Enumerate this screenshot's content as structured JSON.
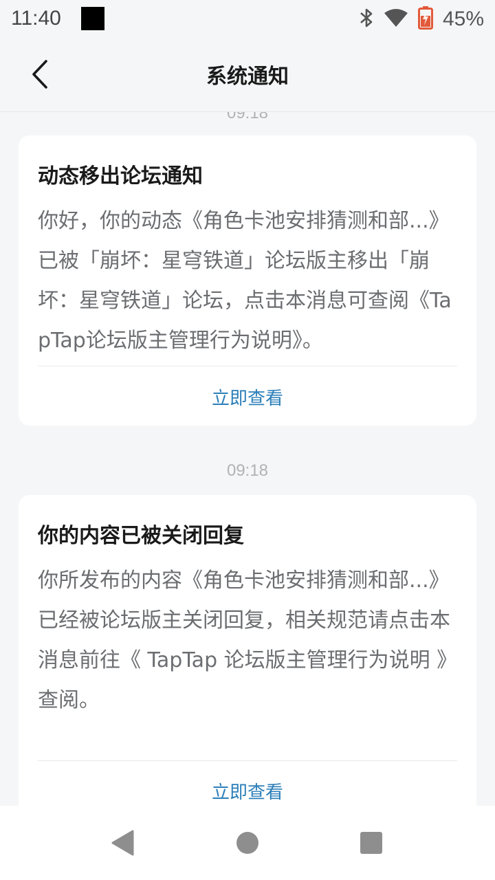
{
  "status_bar": {
    "time": "11:40",
    "battery_percent": "45%",
    "icons": [
      "bluetooth-icon",
      "wifi-icon",
      "battery-icon"
    ]
  },
  "header": {
    "title": "系统通知",
    "back_icon": "chevron-left-icon"
  },
  "notifications": [
    {
      "time": "09:18",
      "title": "动态移出论坛通知",
      "body": "你好，你的动态《角色卡池安排猜测和部...》已被「崩坏：星穹铁道」论坛版主移出「崩坏：星穹铁道」论坛，点击本消息可查阅《TapTap论坛版主管理行为说明》。",
      "action": "立即查看"
    },
    {
      "time": "09:18",
      "title": "你的内容已被关闭回复",
      "body": "你所发布的内容《角色卡池安排猜测和部...》已经被论坛版主关闭回复，相关规范请点击本消息前往《 TapTap 论坛版主管理行为说明 》查阅。",
      "action": "立即查看"
    }
  ],
  "nav_bar": {
    "icons": [
      "back-triangle-icon",
      "home-circle-icon",
      "recents-square-icon"
    ]
  },
  "colors": {
    "background": "#f5f6f7",
    "card": "#ffffff",
    "link": "#2c7fb8",
    "body_text": "#6b6d70"
  }
}
